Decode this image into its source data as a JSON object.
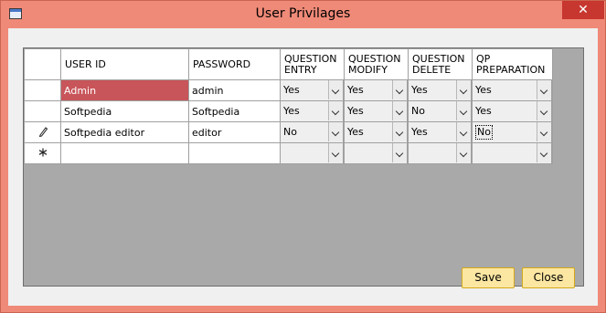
{
  "window": {
    "title": "User Privilages",
    "close_glyph": "✕",
    "accent": "#f08a78"
  },
  "grid": {
    "columns": [
      "USER ID",
      "PASSWORD",
      "QUESTION ENTRY",
      "QUESTION MODIFY",
      "QUESTION DELETE",
      "QP PREPARATION"
    ],
    "rows": [
      {
        "indicator": "",
        "user_id": "Admin",
        "password": "admin",
        "entry": "Yes",
        "modify": "Yes",
        "delete": "Yes",
        "qp": "Yes",
        "selected": true
      },
      {
        "indicator": "",
        "user_id": "Softpedia",
        "password": "Softpedia",
        "entry": "Yes",
        "modify": "Yes",
        "delete": "No",
        "qp": "Yes"
      },
      {
        "indicator": "pencil",
        "user_id": "Softpedia editor",
        "password": "editor",
        "entry": "No",
        "modify": "Yes",
        "delete": "Yes",
        "qp": "No"
      },
      {
        "indicator": "new-row-asterisk",
        "user_id": "",
        "password": "",
        "entry": "",
        "modify": "",
        "delete": "",
        "qp": ""
      }
    ],
    "selected_color": "#c8555a",
    "background_color": "#a9a9a9"
  },
  "buttons": {
    "save": "Save",
    "close": "Close"
  }
}
